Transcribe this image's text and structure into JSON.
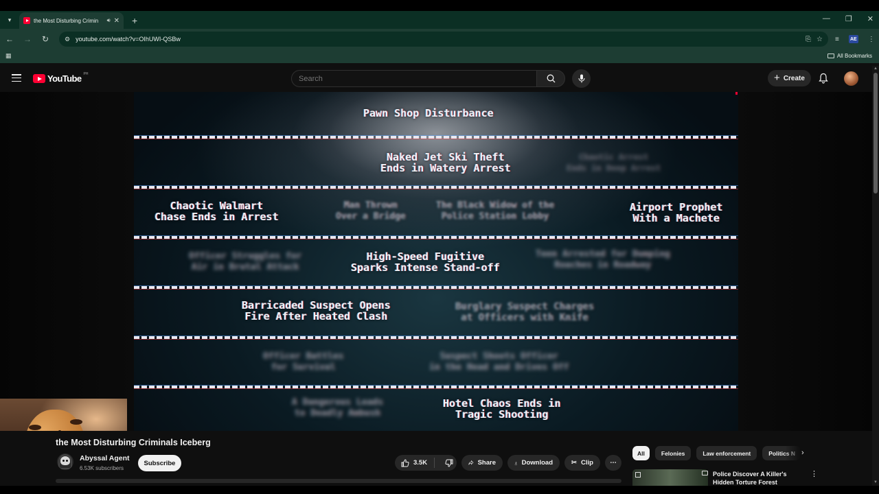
{
  "browser": {
    "tab_title": "the Most Disturbing Crimin",
    "url": "youtube.com/watch?v=OIhUWI-QSBw",
    "bookmarks_label": "All Bookmarks"
  },
  "masthead": {
    "logo_text": "YouTube",
    "country_code": "PH",
    "search_placeholder": "Search",
    "create_label": "Create"
  },
  "video": {
    "iceberg_entries": [
      "Pawn Shop Disturbance",
      "Naked Jet Ski Theft",
      "Ends in Watery Arrest",
      "Chaotic Walmart",
      "Chase Ends in Arrest",
      "Airport Prophet",
      "With a Machete",
      "High-Speed Fugitive",
      "Sparks Intense Stand-off",
      "Barricaded Suspect Opens",
      "Fire After Heated Clash",
      "Hotel Chaos Ends in",
      "Tragic Shooting"
    ],
    "blurred_entries": [
      "Man Thrown",
      "Over a Bridge",
      "The Black Widow of the",
      "Police Station Lobby",
      "Officer Struggles for",
      "Air in Brutal Attack",
      "Teen Arrested for Dumping",
      "Roaches in Roadway",
      "Burglary Suspect Charges",
      "at Officers with Knife",
      "Officer Battles",
      "for Survival",
      "Suspect Shoots Officer",
      "in the Head and Drives Off",
      "A Dangerous Leads",
      "to Deadly Ambush",
      "Chaotic Arrest",
      "Ends in Deep Arrest"
    ]
  },
  "details": {
    "title": "the Most Disturbing Criminals Iceberg",
    "channel_name": "Abyssal Agent",
    "subscribers": "6.53K subscribers",
    "subscribe_label": "Subscribe",
    "likes": "3.5K",
    "share_label": "Share",
    "download_label": "Download",
    "clip_label": "Clip"
  },
  "sidebar": {
    "chips": [
      "All",
      "Felonies",
      "Law enforcement",
      "Politics N"
    ],
    "recommended_title": "Police Discover A Killer's Hidden Torture Forest"
  },
  "colors": {
    "brand_red": "#ff0033",
    "page_bg": "#0f0f0f",
    "chrome_green": "#1d3d33"
  }
}
